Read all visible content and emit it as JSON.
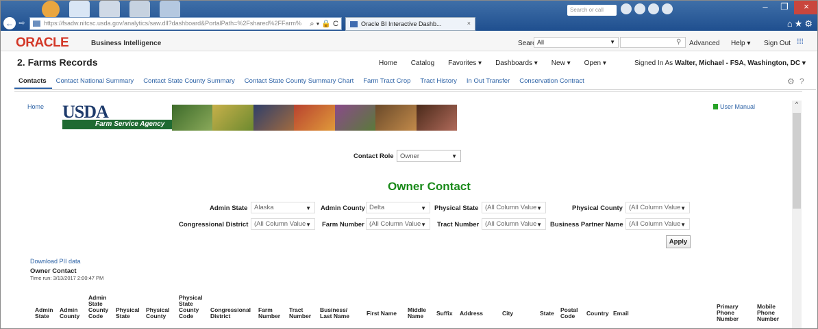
{
  "browser": {
    "url": "https://fsadw.nitcsc.usda.gov/analytics/saw.dll?dashboard&PortalPath=%2Fshared%2FFarm%",
    "tab_title": "Oracle BI Interactive Dashb...",
    "search_placeholder": "Search or call",
    "tab_close": "×",
    "nav_back": "←",
    "nav_fwd": "⇨",
    "url_tools": "⌕ ▾ 🔒 C",
    "right_icons": "⌂★⚙",
    "win_min": "–",
    "win_max": "❐",
    "win_close": "×"
  },
  "obiee": {
    "brand": "ORACLE",
    "product": "Business Intelligence",
    "search_label": "Search",
    "search_scope": "All",
    "search_caret": "▼",
    "search_icon": "⚲",
    "advanced": "Advanced",
    "help": "Help ▾",
    "signout": "Sign Out",
    "more": "⁞⁞⁞"
  },
  "dashboard": {
    "title": "2. Farms Records",
    "nav": [
      "Home",
      "Catalog",
      "Favorites ▾",
      "Dashboards ▾",
      "New ▾",
      "Open ▾"
    ],
    "signed_in_label": "Signed In As",
    "signed_in_user": "Walter, Michael - FSA, Washington, DC ▾",
    "tabs": [
      "Contacts",
      "Contact National Summary",
      "Contact State County Summary",
      "Contact State County Summary Chart",
      "Farm Tract Crop",
      "Tract History",
      "In Out Transfer",
      "Conservation Contract"
    ],
    "gear_icon": "⚙",
    "help_icon": "?"
  },
  "banner": {
    "home": "Home",
    "usda": "USDA",
    "agency": "Farm Service Agency",
    "user_manual": "User Manual",
    "scroll_up": "^"
  },
  "prompts": {
    "contact_role_label": "Contact Role",
    "contact_role_value": "Owner",
    "heading": "Owner Contact",
    "admin_state_label": "Admin State",
    "admin_state_value": "Alaska",
    "admin_county_label": "Admin County",
    "admin_county_value": "Delta",
    "physical_state_label": "Physical State",
    "physical_state_value": "(All Column Value",
    "physical_county_label": "Physical County",
    "physical_county_value": "(All Column Value",
    "cong_district_label": "Congressional District",
    "cong_district_value": "(All Column Value",
    "farm_number_label": "Farm Number",
    "farm_number_value": "(All Column Value",
    "tract_number_label": "Tract Number",
    "tract_number_value": "(All Column Value",
    "bp_name_label": "Business Partner Name",
    "bp_name_value": "(All Column Value",
    "caret": "▼",
    "apply": "Apply"
  },
  "report": {
    "download": "Download PII data",
    "title": "Owner Contact",
    "time_run": "Time run: 3/13/2017 2:00:47 PM",
    "columns": [
      "Admin State",
      "Admin County",
      "Admin State County Code",
      "Physical State",
      "Physical County",
      "Physical State County Code",
      "Congressional District",
      "Farm Number",
      "Tract Number",
      "Business/ Last Name",
      "First Name",
      "Middle Name",
      "Suffix",
      "Address",
      "City",
      "State",
      "Postal Code",
      "Country",
      "Email",
      "Primary Phone Number",
      "Mobile Phone Number"
    ]
  },
  "colors": {
    "oracle_red": "#d33727",
    "link_blue": "#2e63a6",
    "heading_green": "#1a8a1a",
    "usda_navy": "#1d3a6b",
    "fsa_green": "#1f6a32"
  }
}
